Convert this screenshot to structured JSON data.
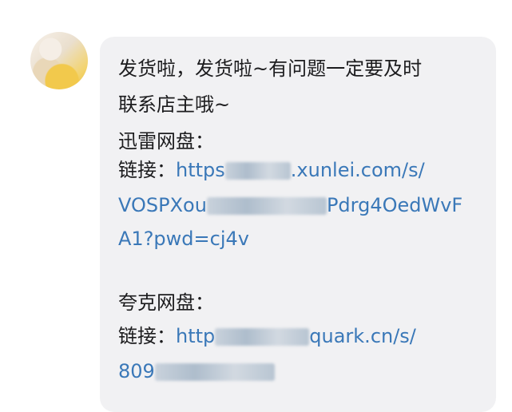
{
  "message": {
    "line1": "发货啦，发货啦~有问题一定要及时",
    "line2": "联系店主哦~",
    "xunlei_title": "迅雷网盘：",
    "xunlei_link_label": "链接：",
    "xunlei_link_part1": "https",
    "xunlei_link_part2": ".xunlei.com/s/",
    "xunlei_link_line2_part1": "VOSPXou",
    "xunlei_link_line2_part2": "Pdrg4OedWvF",
    "xunlei_link_line3": "A1?pwd=cj4v",
    "quark_title": "夸克网盘：",
    "quark_link_label": "链接：",
    "quark_link_part1": "http",
    "quark_link_part2": "quark.cn/s/",
    "quark_link_line2": "809"
  }
}
